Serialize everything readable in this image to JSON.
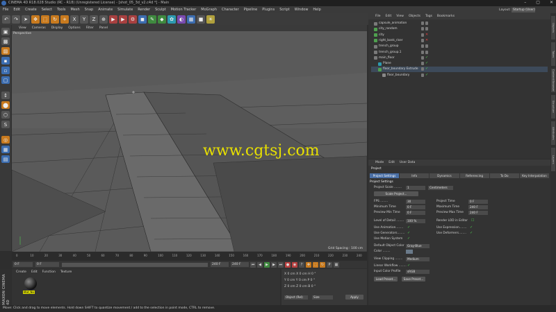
{
  "window": {
    "title": "CINEMA 4D R18.028 Studio (RC - R18) (Unregistered License) - [shot_05_3d_v2.c4d *] - Main",
    "controls": [
      "–",
      "▢",
      "✕"
    ]
  },
  "menubar": {
    "items": [
      "File",
      "Edit",
      "Create",
      "Select",
      "Tools",
      "Mesh",
      "Snap",
      "Animate",
      "Simulate",
      "Render",
      "Sculpt",
      "Motion Tracker",
      "MoGraph",
      "Character",
      "Pipeline",
      "Plugins",
      "Script",
      "Window",
      "Help"
    ],
    "layout_label": "Layout:",
    "layout_value": "Startup (User)"
  },
  "viewport": {
    "menu": [
      "View",
      "Cameras",
      "Display",
      "Options",
      "Filter",
      "Panel"
    ],
    "label": "Perspective",
    "grid_spacing": "Grid Spacing : 100 cm",
    "watermark": "www.cgtsj.com"
  },
  "timeline": {
    "ticks": [
      "0",
      "10",
      "20",
      "30",
      "40",
      "50",
      "60",
      "70",
      "80",
      "90",
      "100",
      "110",
      "120",
      "130",
      "140",
      "150",
      "160",
      "170",
      "180",
      "190",
      "200",
      "210",
      "220",
      "230",
      "240"
    ],
    "end_label": "0 F"
  },
  "transport": {
    "current_frame": "0 F",
    "start_field": "0 F",
    "end_field": "240 F",
    "max_field": "240 F"
  },
  "material_panel": {
    "menu": [
      "Create",
      "Edit",
      "Function",
      "Texture"
    ],
    "material_name": "Mat_No"
  },
  "coord_panel": {
    "rows": [
      "X  0 cm     X  0 cm     H  0 °",
      "Y  0 cm     Y  0 cm     P  0 °",
      "Z  0 cm     Z  0 cm     B  0 °"
    ],
    "mode": "Object (Rel)",
    "size": "Size",
    "apply": "Apply"
  },
  "status": {
    "text": "Move: Click and drag to move elements. Hold down SHIFT to quantize movement / add to the selection in point mode, CTRL to remove."
  },
  "maxon": {
    "text": "MAXON CINEMA 4D"
  },
  "object_manager": {
    "menu": [
      "File",
      "Edit",
      "View",
      "Objects",
      "Tags",
      "Bookmarks"
    ],
    "objects": [
      {
        "name": "capsule_animation",
        "indent": 0,
        "color": "#7a7a7a",
        "state": "off"
      },
      {
        "name": "city_random",
        "indent": 0,
        "color": "#4fa04f",
        "state": "off"
      },
      {
        "name": "city",
        "indent": 0,
        "color": "#4fa04f",
        "state": "x"
      },
      {
        "name": "right_bank_riser",
        "indent": 0,
        "color": "#4fa04f",
        "state": "x"
      },
      {
        "name": "trench_group",
        "indent": 0,
        "color": "#7a7a7a",
        "state": "off"
      },
      {
        "name": "trench_group.1",
        "indent": 0,
        "color": "#7a7a7a",
        "state": "off"
      },
      {
        "name": "main_floor",
        "indent": 0,
        "color": "#7a7a7a",
        "state": "on"
      },
      {
        "name": "Plane",
        "indent": 1,
        "color": "#2d9ab0",
        "state": "on"
      },
      {
        "name": "floor_boundary Extrude",
        "indent": 1,
        "color": "#4fa04f",
        "state": "on"
      },
      {
        "name": "floor_boundary",
        "indent": 2,
        "color": "#888888",
        "state": "on"
      }
    ]
  },
  "attribute_manager": {
    "menu": [
      "Mode",
      "Edit",
      "User Data"
    ],
    "title": "Project",
    "tabs": [
      "Project Settings",
      "Info",
      "Dynamics",
      "Referencing",
      "To Do",
      "Key Interpolation"
    ],
    "section": "Project Settings",
    "project_scale_label": "Project Scale ........",
    "project_scale_value": "1",
    "project_scale_unit": "Centimeters",
    "scale_project_btn": "Scale Project...",
    "fps_label": "FPS ........",
    "fps_value": "30",
    "project_time_label": "Project Time",
    "project_time_value": "0 F",
    "min_time_label": "Minimum Time",
    "min_time_value": "0 F",
    "max_time_label": "Maximum Time",
    "max_time_value": "240 F",
    "prev_min_label": "Preview Min Time",
    "prev_min_value": "0 F",
    "prev_max_label": "Preview Max Time",
    "prev_max_value": "240 F",
    "lod_label": "Level of Detail ........",
    "lod_value": "100 %",
    "render_lod_label": "Render LOD in Editor",
    "use_anim_label": "Use Animation........",
    "use_expr_label": "Use Expression........",
    "use_gen_label": "Use Generators........",
    "use_def_label": "Use Deformers........",
    "use_motion_label": "Use Motion System",
    "def_color_label": "Default Object Color",
    "def_color_value": "Gray-Blue",
    "color_label": "Color ........",
    "view_clip_label": "View Clipping ........",
    "view_clip_value": "Medium",
    "linear_wf_label": "Linear Workflow ........",
    "input_profile_label": "Input Color Profile",
    "input_profile_value": "sRGB",
    "load_preset": "Load Preset...",
    "save_preset": "Save Preset..."
  },
  "side_tabs": [
    "Objects",
    "Takes",
    "Content Browser",
    "Structure",
    "Attributes",
    "Layers"
  ]
}
